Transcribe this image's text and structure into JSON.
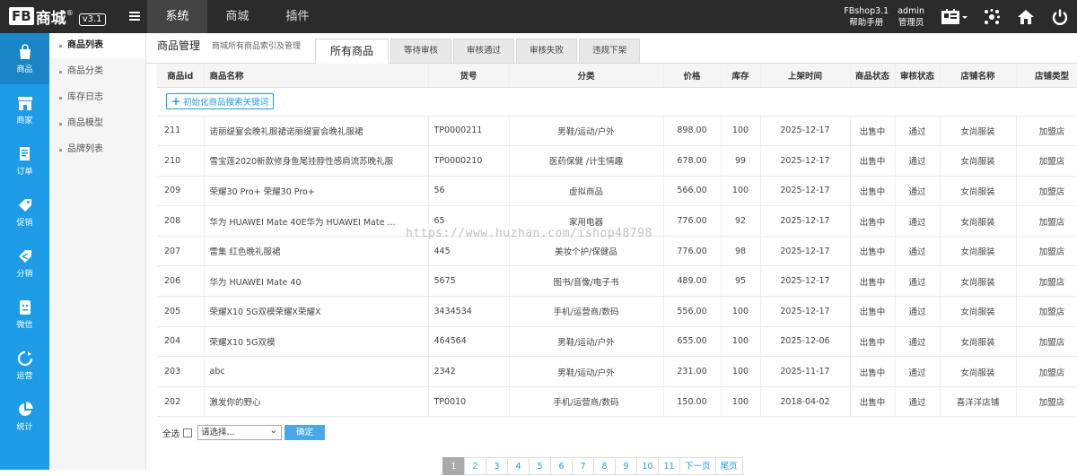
{
  "logo": {
    "brand": "FB",
    "name": "商城",
    "reg": "®",
    "version": "v3.1"
  },
  "topnav": [
    "系统",
    "商城",
    "插件"
  ],
  "topright": {
    "product": "FBshop3.1",
    "help": "帮助手册",
    "user": "admin",
    "role": "管理员"
  },
  "sidebar": [
    "商品",
    "商家",
    "订单",
    "促销",
    "分销",
    "微信",
    "运营",
    "统计"
  ],
  "submenu": [
    "商品列表",
    "商品分类",
    "库存日志",
    "商品模型",
    "品牌列表"
  ],
  "header": {
    "title": "商品管理",
    "desc": "商城所有商品索引及管理"
  },
  "tabs": [
    "所有商品",
    "等待审核",
    "审核通过",
    "审核失败",
    "违规下架"
  ],
  "table": {
    "columns": [
      "商品id",
      "商品名称",
      "货号",
      "分类",
      "价格",
      "库存",
      "上架时间",
      "商品状态",
      "审核状态",
      "店铺名称",
      "店铺类型"
    ],
    "init_button": "初始化商品搜索关键词",
    "rows": [
      [
        "211",
        "诺丽缇宴会晚礼服裙诺丽缇宴会晚礼服裙",
        "TP0000211",
        "男鞋/运动/户外",
        "898.00",
        "100",
        "2025-12-17",
        "出售中",
        "通过",
        "女尚服装",
        "加盟店"
      ],
      [
        "210",
        "雪宝莲2020新款修身鱼尾挂脖性感肩流苏晚礼服",
        "TP0000210",
        "医药保健 /计生情趣",
        "678.00",
        "99",
        "2025-12-17",
        "出售中",
        "通过",
        "女尚服装",
        "加盟店"
      ],
      [
        "209",
        "荣耀30 Pro+ 荣耀30 Pro+",
        "56",
        "虚拟商品",
        "566.00",
        "100",
        "2025-12-17",
        "出售中",
        "通过",
        "女尚服装",
        "加盟店"
      ],
      [
        "208",
        "华为 HUAWEI Mate 40E华为 HUAWEI Mate ...",
        "65",
        "家用电器",
        "776.00",
        "92",
        "2025-12-17",
        "出售中",
        "通过",
        "女尚服装",
        "加盟店"
      ],
      [
        "207",
        "雷集 红色晚礼服裙",
        "445",
        "美妆个护/保健品",
        "776.00",
        "98",
        "2025-12-17",
        "出售中",
        "通过",
        "女尚服装",
        "加盟店"
      ],
      [
        "206",
        "华为 HUAWEI Mate 40",
        "5675",
        "图书/音像/电子书",
        "489.00",
        "95",
        "2025-12-17",
        "出售中",
        "通过",
        "女尚服装",
        "加盟店"
      ],
      [
        "205",
        "荣耀X10 5G双模荣耀X荣耀X",
        "3434534",
        "手机/运营商/数码",
        "556.00",
        "100",
        "2025-12-17",
        "出售中",
        "通过",
        "女尚服装",
        "加盟店"
      ],
      [
        "204",
        "荣耀X10 5G双模",
        "464564",
        "男鞋/运动/户外",
        "655.00",
        "100",
        "2025-12-06",
        "出售中",
        "通过",
        "女尚服装",
        "加盟店"
      ],
      [
        "203",
        "abc",
        "2342",
        "男鞋/运动/户外",
        "231.00",
        "100",
        "2025-11-17",
        "出售中",
        "通过",
        "女尚服装",
        "加盟店"
      ],
      [
        "202",
        "激发你的野心",
        "TP0010",
        "手机/运营商/数码",
        "150.00",
        "100",
        "2018-04-02",
        "出售中",
        "通过",
        "喜洋洋店铺",
        "加盟店"
      ]
    ]
  },
  "bulk": {
    "select_all": "全选",
    "select_placeholder": "请选择...",
    "confirm": "确定"
  },
  "pagination": [
    "1",
    "2",
    "3",
    "4",
    "5",
    "6",
    "7",
    "8",
    "9",
    "10",
    "11",
    "下一页",
    "尾页"
  ],
  "watermark": "https://www.huzhan.com/ishop48798",
  "colors": {
    "topbar": "#2b2b2b",
    "sidebar": "#1e9ce7",
    "accent": "#1e9ce7"
  }
}
